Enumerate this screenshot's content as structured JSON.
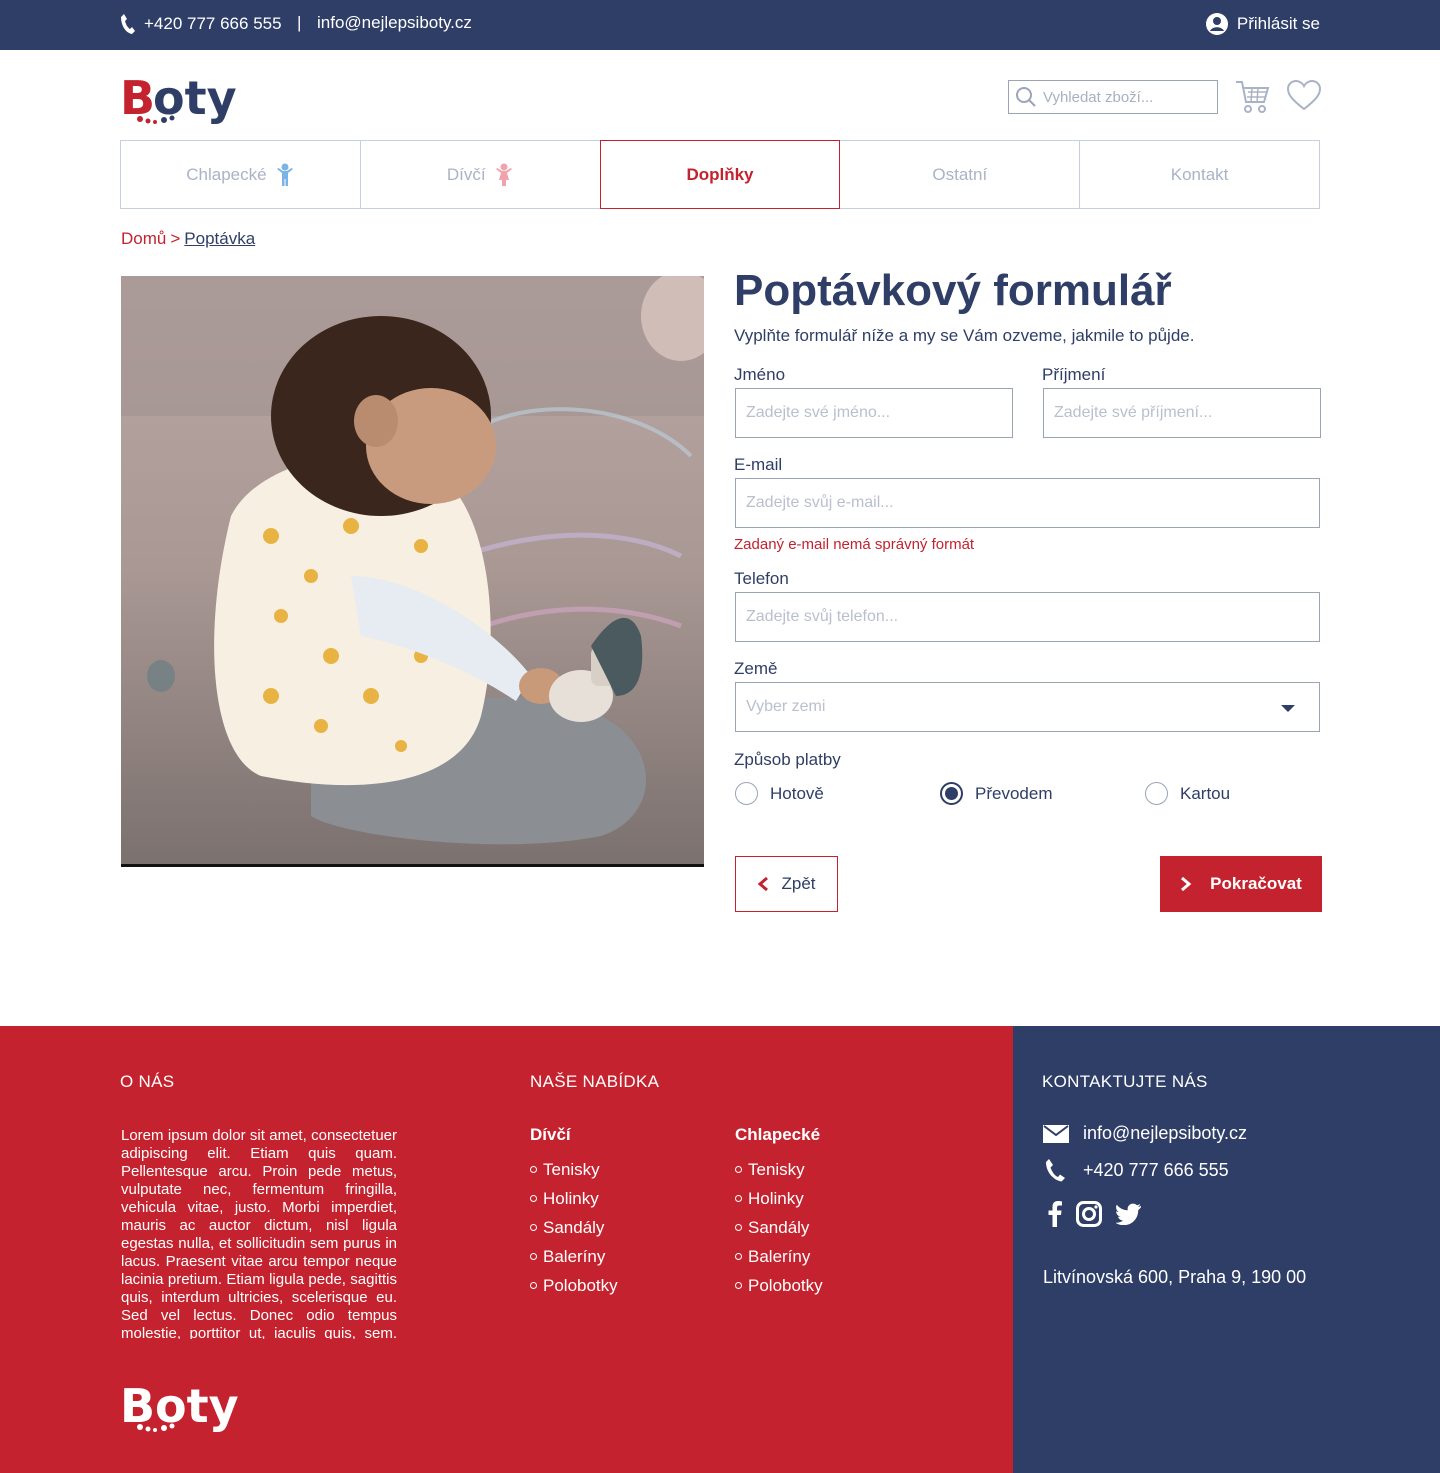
{
  "topbar": {
    "phone": "+420 777 666 555",
    "separator": "|",
    "email": "info@nejlepsiboty.cz",
    "login": "Přihlásit se"
  },
  "header": {
    "logo_text": "Boty",
    "search_placeholder": "Vyhledat zboží..."
  },
  "nav": {
    "tabs": [
      {
        "label": "Chlapecké",
        "icon": "boy-icon",
        "color": "#7ab3e6"
      },
      {
        "label": "Dívčí",
        "icon": "girl-icon",
        "color": "#f0a3ad"
      },
      {
        "label": "Doplňky",
        "active": true
      },
      {
        "label": "Ostatní"
      },
      {
        "label": "Kontakt"
      }
    ]
  },
  "breadcrumb": {
    "home": "Domů",
    "separator": ">",
    "current": "Poptávka"
  },
  "form": {
    "title": "Poptávkový formulář",
    "intro": "Vyplňte formulář níže a my se Vám ozveme, jakmile to půjde.",
    "first_name": {
      "label": "Jméno",
      "placeholder": "Zadejte své jméno..."
    },
    "last_name": {
      "label": "Příjmení",
      "placeholder": "Zadejte své příjmení..."
    },
    "email": {
      "label": "E-mail",
      "placeholder": "Zadejte svůj e-mail...",
      "error": "Zadaný e-mail nemá správný formát"
    },
    "phone": {
      "label": "Telefon",
      "placeholder": "Zadejte svůj telefon..."
    },
    "country": {
      "label": "Země",
      "value": "Vyber zemi"
    },
    "payment": {
      "label": "Způsob platby",
      "options": [
        {
          "label": "Hotově",
          "checked": false
        },
        {
          "label": "Převodem",
          "checked": true
        },
        {
          "label": "Kartou",
          "checked": false
        }
      ]
    },
    "back_label": "Zpět",
    "next_label": "Pokračovat"
  },
  "footer": {
    "about": {
      "title": "O NÁS",
      "text": "Lorem ipsum dolor sit amet, consectetuer adipiscing elit. Etiam quis quam. Pellentesque arcu. Proin pede metus, vulputate nec, fermentum fringilla, vehicula vitae, justo. Morbi imperdiet, mauris ac auctor dictum, nisl ligula egestas nulla, et sollicitudin sem purus in lacus. Praesent vitae arcu tempor neque lacinia pretium. Etiam ligula pede, sagittis quis, interdum ultricies, scelerisque eu. Sed vel lectus. Donec odio tempus molestie, porttitor ut, iaculis quis, sem. Pellentesque arcu. Vestibulum fermentum tortor id mi."
    },
    "offer": {
      "title": "NAŠE NABÍDKA",
      "girls": {
        "title": "Dívčí",
        "items": [
          "Tenisky",
          "Holinky",
          "Sandály",
          "Baleríny",
          "Polobotky"
        ]
      },
      "boys": {
        "title": "Chlapecké",
        "items": [
          "Tenisky",
          "Holinky",
          "Sandály",
          "Baleríny",
          "Polobotky"
        ]
      }
    },
    "contact": {
      "title": "KONTAKTUJTE NÁS",
      "email": "info@nejlepsiboty.cz",
      "phone": "+420 777 666 555",
      "address": "Litvínovská 600, Praha 9, 190 00"
    }
  },
  "colors": {
    "navy": "#2f3e66",
    "red": "#c4222e"
  }
}
